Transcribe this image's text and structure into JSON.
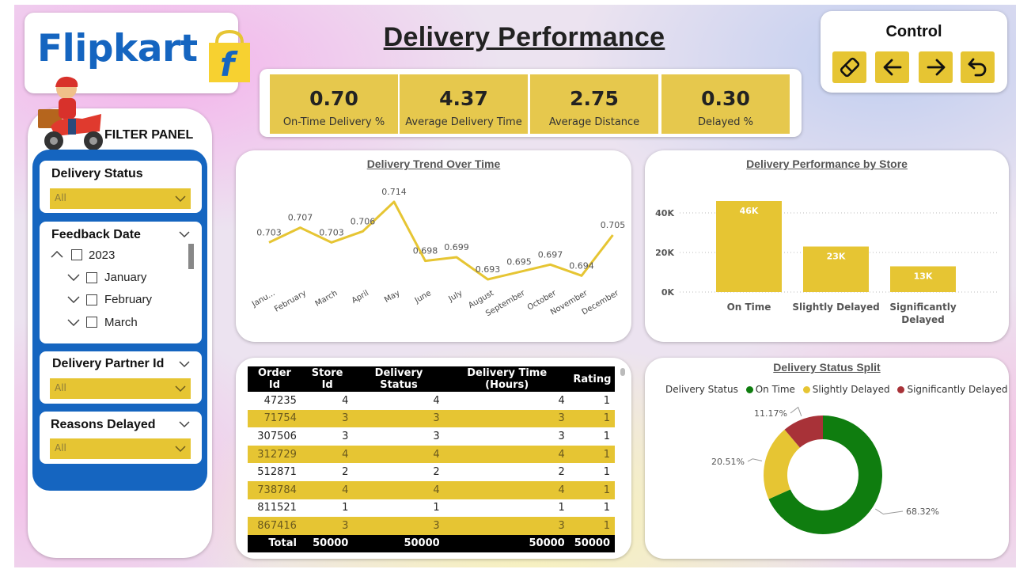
{
  "header": {
    "logo_text": "Flipkart",
    "logo_bag_letter": "f",
    "title": "Delivery Performance"
  },
  "control": {
    "title": "Control",
    "buttons": [
      "eraser-icon",
      "arrow-left-icon",
      "arrow-right-icon",
      "undo-icon"
    ]
  },
  "kpis": [
    {
      "value": "0.70",
      "label": "On-Time Delivery %"
    },
    {
      "value": "4.37",
      "label": "Average Delivery Time"
    },
    {
      "value": "2.75",
      "label": "Average Distance"
    },
    {
      "value": "0.30",
      "label": "Delayed %"
    }
  ],
  "filter_panel": {
    "title": "FILTER PANEL",
    "delivery_status": {
      "label": "Delivery Status",
      "value": "All"
    },
    "feedback_date": {
      "label": "Feedback Date",
      "year": "2023",
      "months": [
        "January",
        "February",
        "March"
      ]
    },
    "delivery_partner": {
      "label": "Delivery Partner Id",
      "value": "All"
    },
    "reasons_delayed": {
      "label": "Reasons Delayed",
      "value": "All"
    }
  },
  "colors": {
    "accent_yellow": "#e6c533",
    "brand_blue": "#1565c0",
    "on_time": "#0f7d0f",
    "slightly_delayed": "#e6c533",
    "significantly_delayed": "#a83238"
  },
  "chart_data": [
    {
      "type": "line",
      "title": "Delivery Trend Over Time",
      "categories": [
        "Janu...",
        "February",
        "March",
        "April",
        "May",
        "June",
        "July",
        "August",
        "September",
        "October",
        "November",
        "December"
      ],
      "values": [
        0.703,
        0.707,
        0.703,
        0.706,
        0.714,
        0.698,
        0.699,
        0.693,
        0.695,
        0.697,
        0.694,
        0.705
      ],
      "data_labels": [
        "0.703",
        "0.707",
        "0.703",
        "0.706",
        "0.714",
        "0.698",
        "0.699",
        "0.693",
        "0.695",
        "0.697",
        "0.694",
        "0.705"
      ],
      "color": "#e6c533",
      "grid": false
    },
    {
      "type": "bar",
      "title": "Delivery Performance by Store",
      "categories": [
        "On Time",
        "Slightly Delayed",
        "Significantly Delayed"
      ],
      "values": [
        46000,
        23000,
        13000
      ],
      "data_labels": [
        "46K",
        "23K",
        "13K"
      ],
      "yticks": [
        "0K",
        "20K",
        "40K"
      ],
      "ylim": [
        0,
        50000
      ],
      "color": "#e6c533",
      "grid": true
    },
    {
      "type": "pie",
      "title": "Delivery Status Split",
      "legend_title": "Delivery Status",
      "legend_position": "top",
      "categories": [
        "On Time",
        "Slightly Delayed",
        "Significantly Delayed"
      ],
      "values": [
        68.32,
        20.51,
        11.17
      ],
      "data_labels": [
        "68.32%",
        "20.51%",
        "11.17%"
      ],
      "colors": [
        "#0f7d0f",
        "#e6c533",
        "#a83238"
      ]
    },
    {
      "type": "table",
      "columns": [
        "Order Id",
        "Store Id",
        "Delivery Status",
        "Delivery Time (Hours)",
        "Rating"
      ],
      "rows": [
        [
          "47235",
          "4",
          "4",
          "4",
          "1"
        ],
        [
          "71754",
          "3",
          "3",
          "3",
          "1"
        ],
        [
          "307506",
          "3",
          "3",
          "3",
          "1"
        ],
        [
          "312729",
          "4",
          "4",
          "4",
          "1"
        ],
        [
          "512871",
          "2",
          "2",
          "2",
          "1"
        ],
        [
          "738784",
          "4",
          "4",
          "4",
          "1"
        ],
        [
          "811521",
          "1",
          "1",
          "1",
          "1"
        ],
        [
          "867416",
          "3",
          "3",
          "3",
          "1"
        ]
      ],
      "total": [
        "Total",
        "50000",
        "50000",
        "50000",
        "50000"
      ]
    }
  ]
}
